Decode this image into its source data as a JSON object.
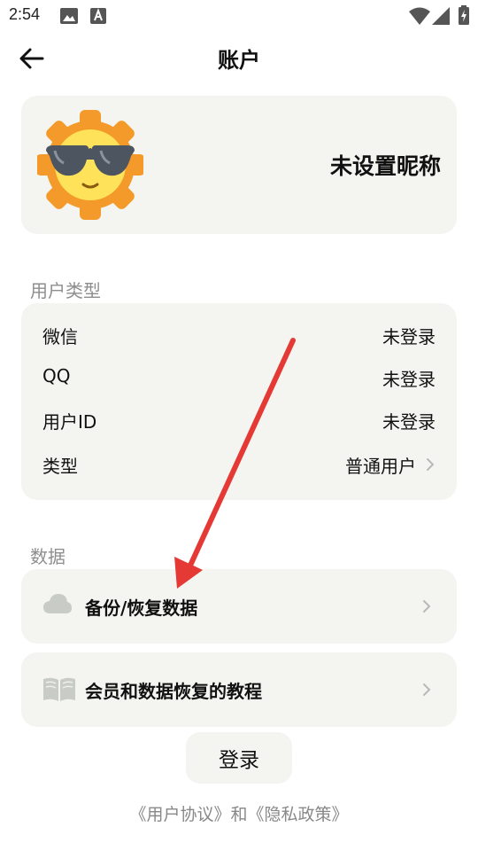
{
  "status_bar": {
    "time": "2:54",
    "icons": [
      "image-icon",
      "font-icon",
      "wifi-icon",
      "signal-icon",
      "battery-icon"
    ]
  },
  "header": {
    "title": "账户",
    "back_icon": "arrow-left-icon"
  },
  "profile": {
    "avatar_icon": "sun-with-sunglasses-icon",
    "nickname": "未设置昵称"
  },
  "user_type_section": {
    "label": "用户类型",
    "rows": [
      {
        "key": "微信",
        "value": "未登录"
      },
      {
        "key": "QQ",
        "value": "未登录"
      },
      {
        "key": "用户ID",
        "value": "未登录"
      },
      {
        "key": "类型",
        "value": "普通用户",
        "chevron": true
      }
    ]
  },
  "data_section": {
    "label": "数据",
    "items": [
      {
        "icon": "cloud-icon",
        "label": "备份/恢复数据"
      },
      {
        "icon": "book-icon",
        "label": "会员和数据恢复的教程"
      }
    ]
  },
  "login_button": "登录",
  "footer": {
    "user_agreement": "《用户协议》",
    "connector": "和",
    "privacy_policy": "《隐私政策》"
  },
  "annotation": {
    "arrow_color": "#e53935"
  },
  "colors": {
    "card_background": "#f4f5f1",
    "section_label": "#8e8e8e",
    "chevron": "#b8b8b8"
  }
}
